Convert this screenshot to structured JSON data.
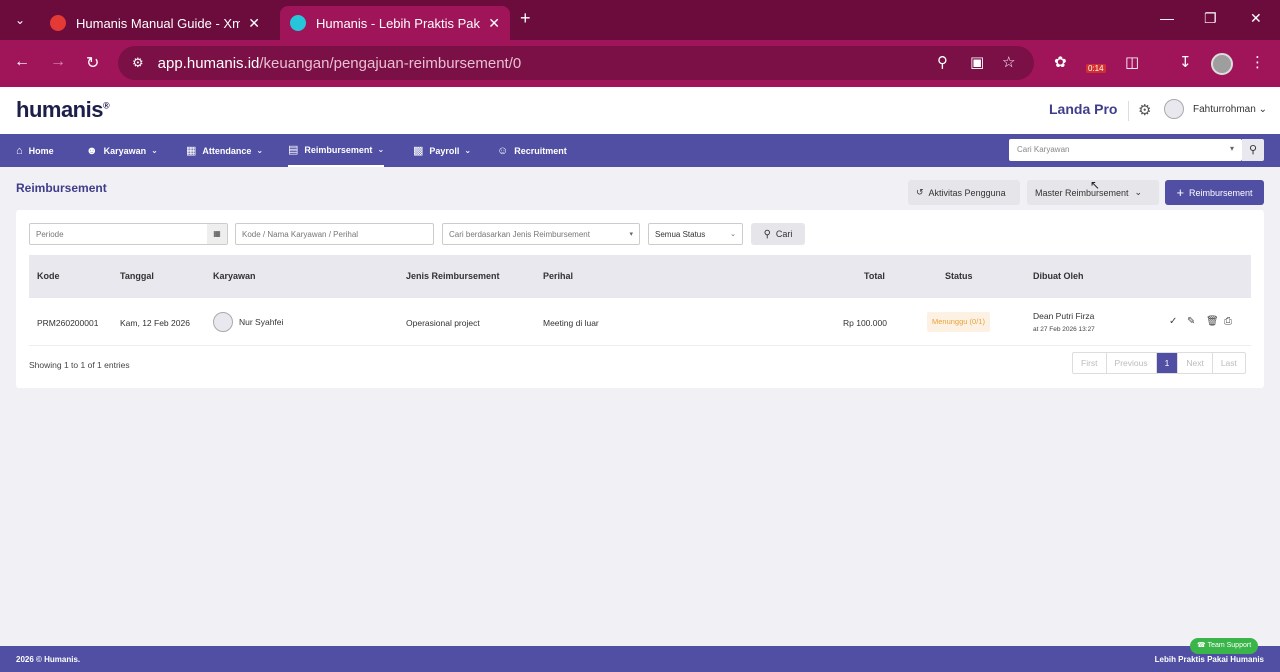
{
  "browser": {
    "tabs": [
      {
        "title": "Humanis Manual Guide - Xmind",
        "favicon_color": "#e53935"
      },
      {
        "title": "Humanis - Lebih Praktis Pakai Humanis",
        "favicon_color": "#26c6da"
      }
    ],
    "url_host": "app.humanis.id",
    "url_path": "/keuangan/pengajuan-reimbursement/0",
    "timer_badge": "0:14"
  },
  "app": {
    "logo": "humanis",
    "company": "Landa Pro",
    "user_name": "Fahturrohman",
    "nav": [
      {
        "label": "Home",
        "icon": "home-icon",
        "dropdown": false
      },
      {
        "label": "Karyawan",
        "icon": "user-check-icon",
        "dropdown": true
      },
      {
        "label": "Attendance",
        "icon": "calendar-icon",
        "dropdown": true
      },
      {
        "label": "Reimbursement",
        "icon": "money-icon",
        "dropdown": true
      },
      {
        "label": "Payroll",
        "icon": "wallet-icon",
        "dropdown": true
      },
      {
        "label": "Recruitment",
        "icon": "users-icon",
        "dropdown": false
      }
    ],
    "search_placeholder": "Cari Karyawan"
  },
  "page": {
    "title": "Reimbursement",
    "btn_activity": "Aktivitas Pengguna",
    "btn_master": "Master Reimbursement",
    "btn_add": "Reimbursement",
    "filters": {
      "periode": "Periode",
      "kode": "Kode / Nama Karyawan / Perihal",
      "jenis": "Cari berdasarkan Jenis Reimbursement",
      "status": "Semua Status",
      "search_btn": "Cari"
    },
    "columns": [
      "Kode",
      "Tanggal",
      "Karyawan",
      "Jenis Reimbursement",
      "Perihal",
      "Total",
      "Status",
      "Dibuat Oleh"
    ],
    "rows": [
      {
        "kode": "PRM260200001",
        "tanggal": "Kam, 12 Feb 2026",
        "karyawan": "Nur Syahfei",
        "jenis": "Operasional project",
        "perihal": "Meeting di luar",
        "total": "Rp 100.000",
        "status": "Menunggu (0/1)",
        "dibuat_oleh": "Dean Putri Firza",
        "dibuat_at": "at 27 Feb 2026 13:27"
      }
    ],
    "entries": "Showing 1 to 1 of 1 entries",
    "pager": {
      "first": "First",
      "prev": "Previous",
      "current": "1",
      "next": "Next",
      "last": "Last"
    }
  },
  "footer": {
    "left": "2026 © Humanis.",
    "right": "Lebih Praktis Pakai Humanis",
    "support": "Team Support"
  },
  "colors": {
    "primary": "#504fa4",
    "browser": "#a0155a",
    "status_pending": "#e8a33b"
  }
}
